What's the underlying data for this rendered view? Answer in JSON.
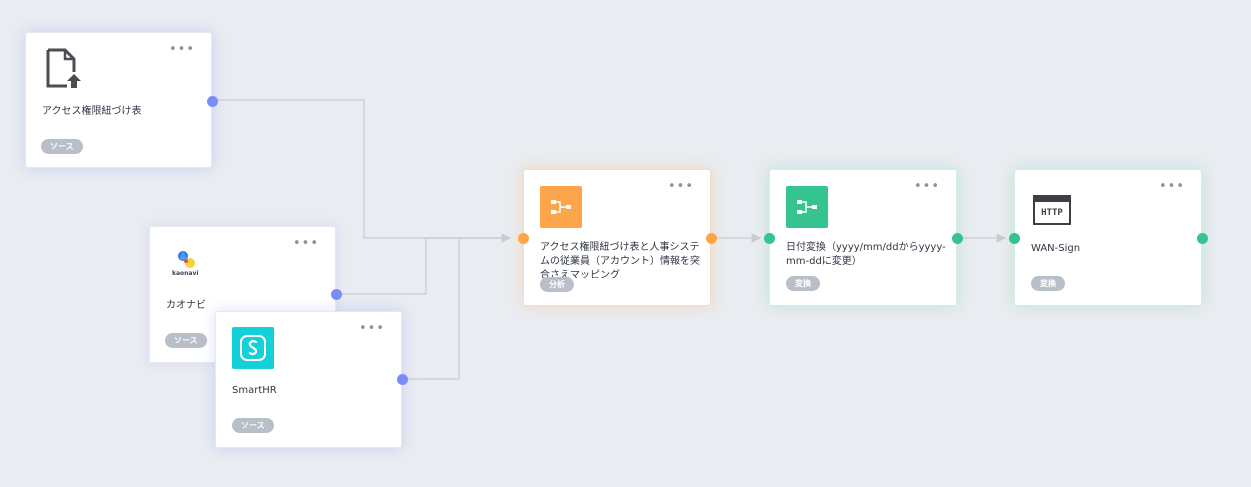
{
  "colors": {
    "source_port": "#7b8cf6",
    "analysis": "#fca54a",
    "transform": "#35c48f",
    "smarthr_bg": "#14d1d9",
    "badge_bg": "#b9bfc9",
    "edge": "#c8ccd3"
  },
  "menu_glyph": "•••",
  "nodes": {
    "access_table": {
      "label": "アクセス権限紐づけ表",
      "badge": "ソース",
      "icon": "file-upload-icon"
    },
    "kaonavi": {
      "label": "カオナビ",
      "badge": "ソース",
      "icon": "kaonavi-logo",
      "logo_text": "kaonavi"
    },
    "smarthr": {
      "label": "SmartHR",
      "badge": "ソース",
      "icon": "smarthr-logo"
    },
    "mapping": {
      "label": "アクセス権限紐づけ表と人事システムの従業員（アカウント）情報を突合さえマッピング",
      "badge": "分析",
      "icon": "flow-split-icon"
    },
    "date_convert": {
      "label": "日付変換（yyyy/mm/ddからyyyy-mm-ddに変更）",
      "badge": "変換",
      "icon": "flow-split-icon"
    },
    "wan_sign": {
      "label": "WAN-Sign",
      "badge": "変換",
      "icon": "http-icon",
      "icon_text": "HTTP"
    }
  }
}
